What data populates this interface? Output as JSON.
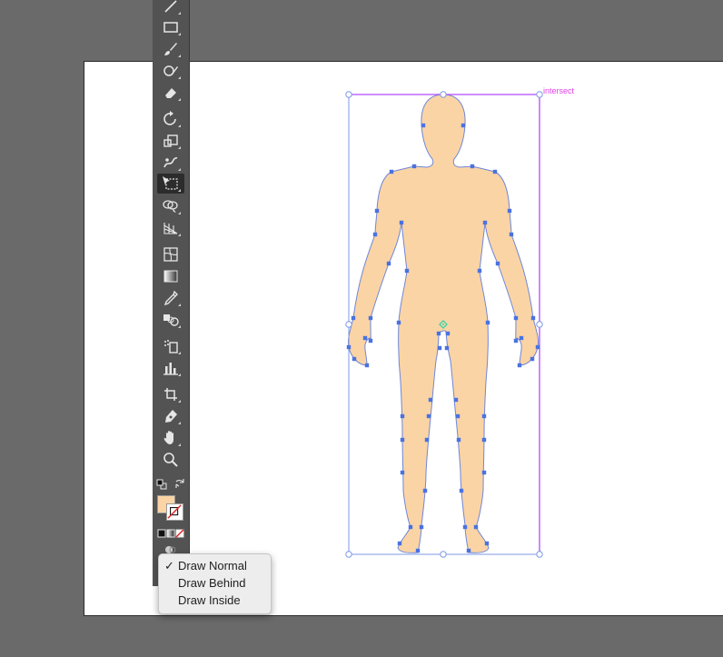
{
  "colors": {
    "figure_fill": "#fbd4a5",
    "path_stroke": "#6e86d9",
    "anchor": "#4a72e0",
    "bbox_stroke": "#7d9ae6",
    "guide_magenta": "#b04bff",
    "smart_guide_text": "#e040e8",
    "center_point": "#3fd6a8"
  },
  "smart_guide": {
    "label": "intersect"
  },
  "toolbar": {
    "tools": [
      {
        "name": "line-segment-tool-icon",
        "active": false
      },
      {
        "name": "rectangle-tool-icon",
        "active": false
      },
      {
        "name": "paintbrush-tool-icon",
        "active": false
      },
      {
        "name": "shaper-tool-icon",
        "active": false
      },
      {
        "name": "eraser-tool-icon",
        "active": false
      },
      {
        "name": "rotate-tool-icon",
        "active": false
      },
      {
        "name": "scale-tool-icon",
        "active": false
      },
      {
        "name": "puppet-warp-tool-icon",
        "active": false
      },
      {
        "name": "free-transform-tool-icon",
        "active": true
      },
      {
        "name": "shape-builder-tool-icon",
        "active": false
      },
      {
        "name": "perspective-grid-tool-icon",
        "active": false
      },
      {
        "name": "mesh-tool-icon",
        "active": false
      },
      {
        "name": "gradient-tool-icon",
        "active": false
      },
      {
        "name": "eyedropper-tool-icon",
        "active": false
      },
      {
        "name": "blend-tool-icon",
        "active": false
      },
      {
        "name": "symbol-sprayer-tool-icon",
        "active": false
      },
      {
        "name": "column-graph-tool-icon",
        "active": false
      },
      {
        "name": "artboard-tool-icon",
        "active": false
      },
      {
        "name": "pen-tool-icon",
        "active": false
      },
      {
        "name": "hand-tool-icon",
        "active": false
      },
      {
        "name": "zoom-tool-icon",
        "active": false
      }
    ],
    "fill_color": "#fbd4a5",
    "stroke_color": "none"
  },
  "draw_mode_menu": {
    "items": [
      {
        "label": "Draw Normal",
        "checked": true,
        "check_mark": "✓"
      },
      {
        "label": "Draw Behind",
        "checked": false,
        "check_mark": ""
      },
      {
        "label": "Draw Inside",
        "checked": false,
        "check_mark": ""
      }
    ]
  }
}
